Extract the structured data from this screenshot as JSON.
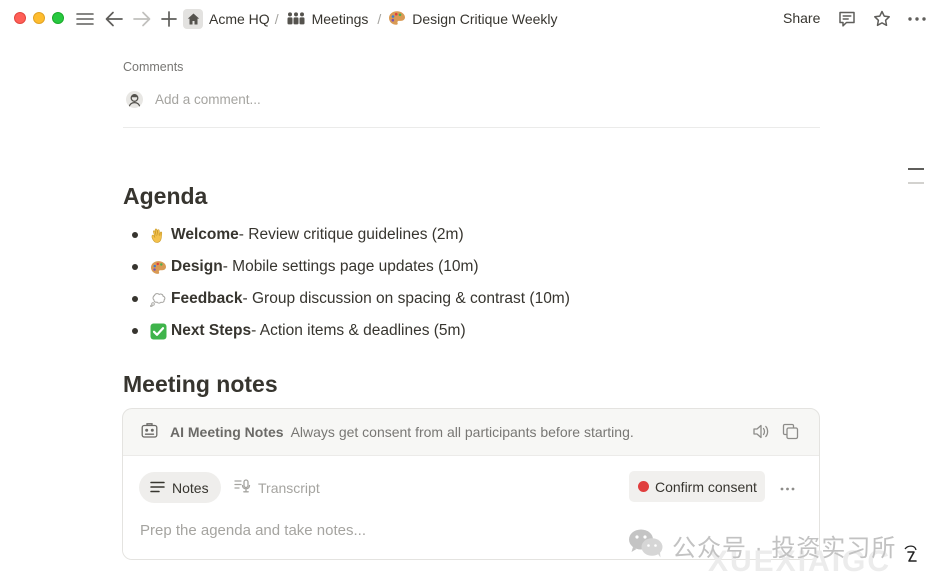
{
  "breadcrumb": {
    "workspace": "Acme HQ",
    "section": "Meetings",
    "page": "Design Critique Weekly"
  },
  "topbar": {
    "share_label": "Share"
  },
  "comments": {
    "label": "Comments",
    "placeholder": "Add a comment..."
  },
  "agenda": {
    "heading": "Agenda",
    "items": [
      {
        "icon": "waving-hand-icon",
        "title": "Welcome",
        "desc": " - Review critique guidelines (2m)"
      },
      {
        "icon": "palette-icon",
        "title": "Design",
        "desc": " - Mobile settings page updates (10m)"
      },
      {
        "icon": "thought-bubble-icon",
        "title": "Feedback",
        "desc": " - Group discussion on spacing & contrast (10m)"
      },
      {
        "icon": "check-mark-button-icon",
        "title": "Next Steps",
        "desc": " - Action items & deadlines (5m)"
      }
    ]
  },
  "meeting_notes": {
    "heading": "Meeting notes",
    "card_title": "AI Meeting Notes",
    "card_subtitle": "Always get consent from all participants before starting.",
    "tab_notes": "Notes",
    "tab_transcript": "Transcript",
    "consent_button": "Confirm consent",
    "notes_placeholder": "Prep the agenda and take notes..."
  },
  "watermark": {
    "text": "公众号 · 投资实习所",
    "sub": "XUEXIAIGC"
  },
  "colors": {
    "record_red": "#e03e3e",
    "text_primary": "#37352f",
    "text_muted": "#a5a4a0"
  }
}
